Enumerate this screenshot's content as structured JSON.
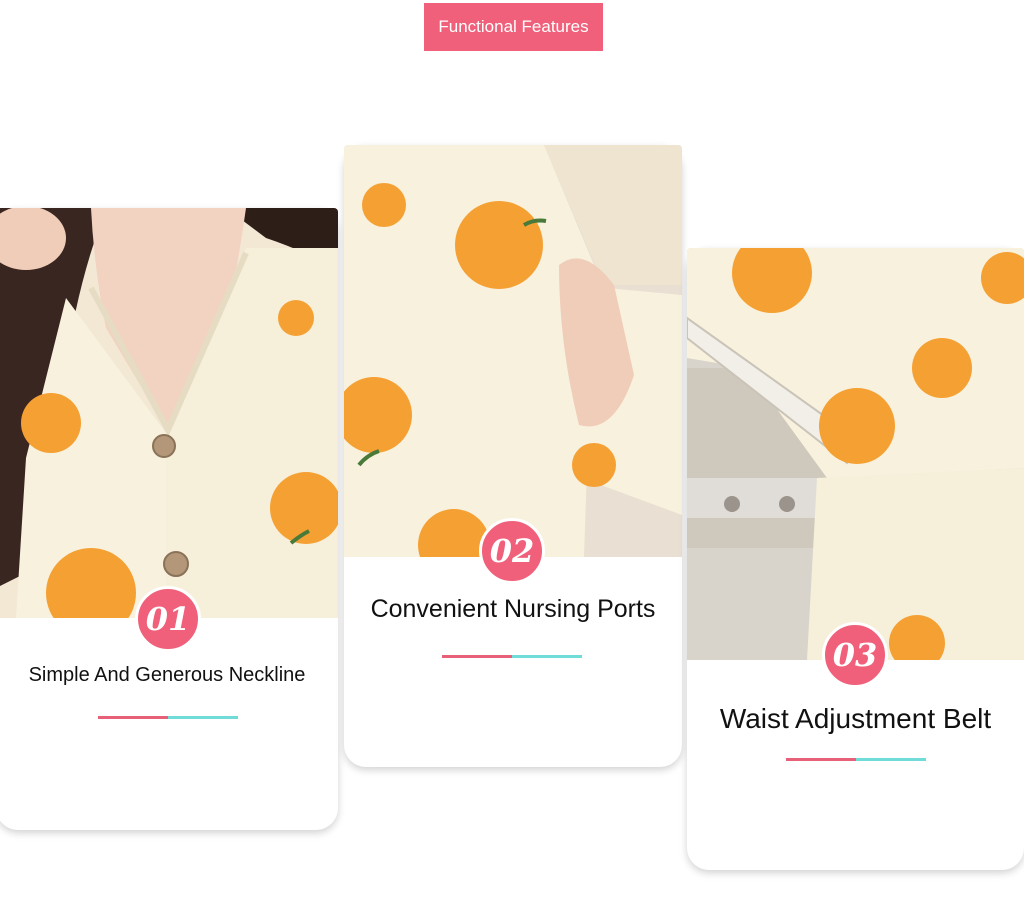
{
  "header": {
    "label": "Functional Features"
  },
  "features": [
    {
      "number": "01",
      "title": "Simple And Generous Neckline",
      "image": "neckline-photo"
    },
    {
      "number": "02",
      "title": "Convenient Nursing Ports",
      "image": "nursing-port-photo"
    },
    {
      "number": "03",
      "title": "Waist Adjustment Belt",
      "image": "waist-belt-photo"
    }
  ],
  "colors": {
    "accent": "#f0607a",
    "divider_pink": "#e86078",
    "divider_cyan": "#6fdcd8",
    "fabric": "#f7f0dc",
    "dot": "#f5a033"
  }
}
